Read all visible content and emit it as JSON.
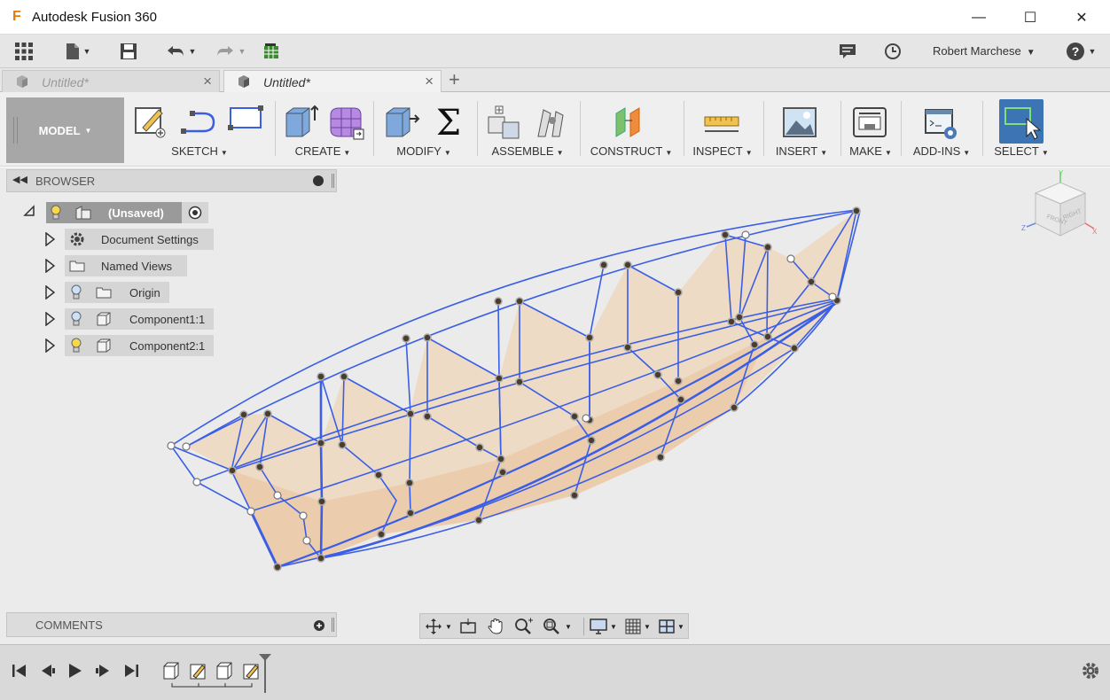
{
  "app": {
    "title": "Autodesk Fusion 360",
    "logo_letter": "F"
  },
  "window_controls": {
    "minimize": "—",
    "maximize": "☐",
    "close": "✕"
  },
  "quick_access": {
    "user_name": "Robert Marchese"
  },
  "tabs": [
    {
      "label": "Untitled*",
      "close": "×"
    },
    {
      "label": "Untitled*",
      "close": "×"
    }
  ],
  "add_tab": "+",
  "workspace": {
    "label": "MODEL"
  },
  "toolbar_groups": [
    {
      "label": "SKETCH"
    },
    {
      "label": "CREATE"
    },
    {
      "label": "MODIFY"
    },
    {
      "label": "ASSEMBLE"
    },
    {
      "label": "CONSTRUCT"
    },
    {
      "label": "INSPECT"
    },
    {
      "label": "INSERT"
    },
    {
      "label": "MAKE"
    },
    {
      "label": "ADD-INS"
    },
    {
      "label": "SELECT"
    }
  ],
  "browser": {
    "title": "BROWSER",
    "root": "(Unsaved)",
    "items": [
      {
        "label": "Document Settings",
        "icon": "gear-icon"
      },
      {
        "label": "Named Views",
        "icon": "folder-icon"
      },
      {
        "label": "Origin",
        "icon": "folder-icon"
      },
      {
        "label": "Component1:1",
        "icon": "component-icon"
      },
      {
        "label": "Component2:1",
        "icon": "component-icon"
      }
    ]
  },
  "comments": {
    "title": "COMMENTS"
  },
  "viewcube": {
    "front": "FRONT",
    "right": "RIGHT",
    "axis_x": "X",
    "axis_y": "Y",
    "axis_z": "Z"
  },
  "colors": {
    "accent_select": "#3c74b4",
    "wireframe": "#3a5ee6",
    "surface": "#f0c89a"
  }
}
